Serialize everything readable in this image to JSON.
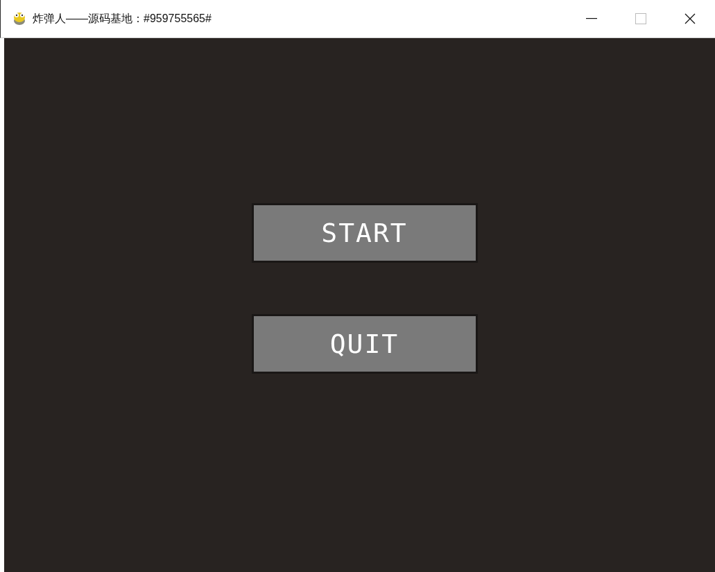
{
  "window": {
    "title": "炸弹人——源码基地：#959755565#"
  },
  "buttons": [
    {
      "label": "START"
    },
    {
      "label": "QUIT"
    }
  ]
}
